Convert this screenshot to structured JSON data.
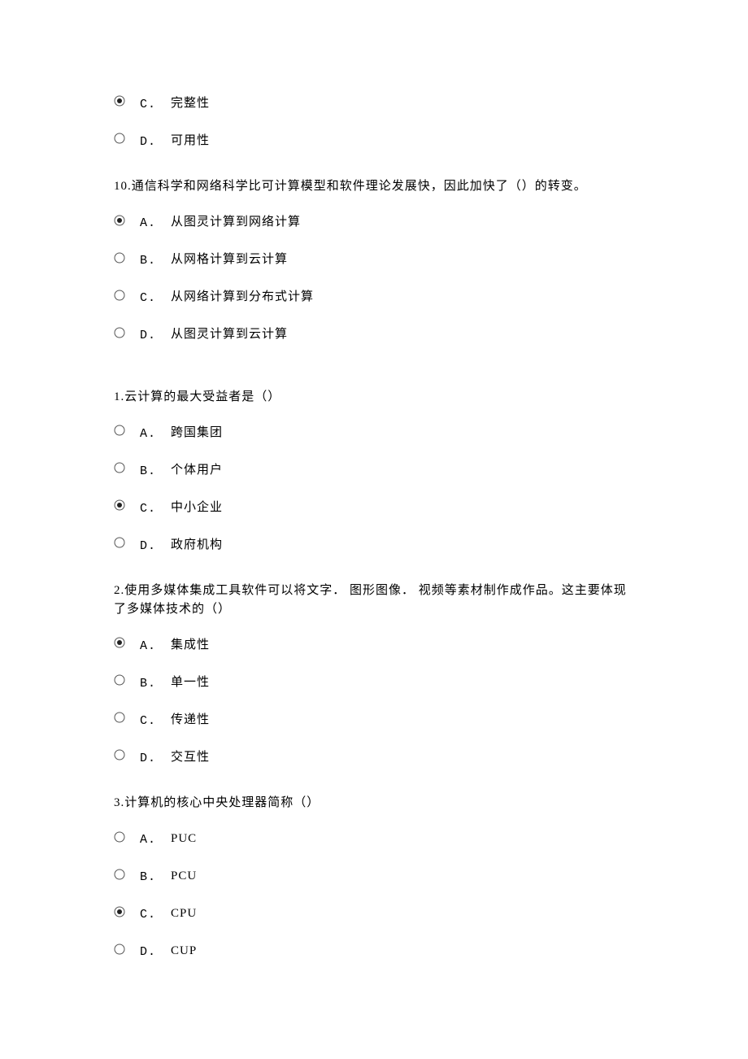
{
  "leading_options": [
    {
      "letter": "C.",
      "text": "完整性",
      "selected": true
    },
    {
      "letter": "D.",
      "text": "可用性",
      "selected": false
    }
  ],
  "questions": [
    {
      "number": "10.",
      "text": "通信科学和网络科学比可计算模型和软件理论发展快，因此加快了（）的转变。",
      "spacer": false,
      "options": [
        {
          "letter": "A.",
          "text": "从图灵计算到网络计算",
          "selected": true
        },
        {
          "letter": "B.",
          "text": "从网格计算到云计算",
          "selected": false
        },
        {
          "letter": "C.",
          "text": "从网络计算到分布式计算",
          "selected": false
        },
        {
          "letter": "D.",
          "text": "从图灵计算到云计算",
          "selected": false
        }
      ]
    },
    {
      "number": "1.",
      "text": "云计算的最大受益者是（）",
      "spacer": true,
      "options": [
        {
          "letter": "A.",
          "text": "跨国集团",
          "selected": false
        },
        {
          "letter": "B.",
          "text": "个体用户",
          "selected": false
        },
        {
          "letter": "C.",
          "text": "中小企业",
          "selected": true
        },
        {
          "letter": "D.",
          "text": "政府机构",
          "selected": false
        }
      ]
    },
    {
      "number": "2.",
      "text": "使用多媒体集成工具软件可以将文字．  图形图像．  视频等素材制作成作品。这主要体现了多媒体技术的（）",
      "spacer": false,
      "options": [
        {
          "letter": "A.",
          "text": "集成性",
          "selected": true
        },
        {
          "letter": "B.",
          "text": "单一性",
          "selected": false
        },
        {
          "letter": "C.",
          "text": "传递性",
          "selected": false
        },
        {
          "letter": "D.",
          "text": "交互性",
          "selected": false
        }
      ]
    },
    {
      "number": "3.",
      "text": "计算机的核心中央处理器简称（）",
      "spacer": false,
      "options": [
        {
          "letter": "A.",
          "text": "PUC",
          "selected": false
        },
        {
          "letter": "B.",
          "text": "PCU",
          "selected": false
        },
        {
          "letter": "C.",
          "text": "CPU",
          "selected": true
        },
        {
          "letter": "D.",
          "text": "CUP",
          "selected": false
        }
      ]
    }
  ]
}
